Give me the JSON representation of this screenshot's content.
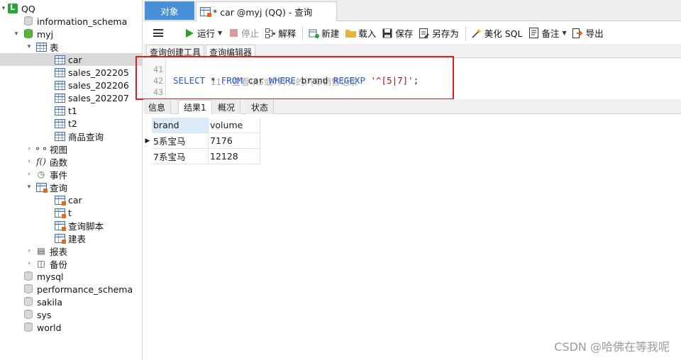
{
  "sidebar": {
    "connection": "QQ",
    "databases_top": [
      "information_schema"
    ],
    "active_db": "myj",
    "tables_group": "表",
    "tables": [
      "car",
      "sales_202205",
      "sales_202206",
      "sales_202207",
      "t1",
      "t2",
      "商品查询"
    ],
    "selected_table": "car",
    "groups": {
      "views": "视图",
      "functions": "函数",
      "events": "事件",
      "queries": "查询",
      "reports": "报表",
      "backups": "备份"
    },
    "queries": [
      "car",
      "t",
      "查询脚本",
      "建表"
    ],
    "databases_bottom": [
      "mysql",
      "performance_schema",
      "sakila",
      "sys",
      "world"
    ]
  },
  "tabs": {
    "objects": "对象",
    "editor": "* car @myj (QQ) - 查询"
  },
  "toolbar": {
    "run": "运行",
    "stop": "停止",
    "explain": "解释",
    "new": "新建",
    "load": "载入",
    "save": "保存",
    "save_as": "另存为",
    "beautify": "美化 SQL",
    "note": "备注",
    "export": "导出"
  },
  "editor_tabs": {
    "builder": "查询创建工具",
    "editor": "查询编辑器"
  },
  "editor": {
    "lines": [
      {
        "num": "41",
        "comment": "-- 11. 查看以5或7开头的汽车销售记录"
      },
      {
        "num": "42",
        "kw1": "SELECT",
        "star": " * ",
        "kw2": "FROM",
        "t1": " car ",
        "kw3": "WHERE",
        "t2": " brand ",
        "kw4": "REGEXP",
        "str": " '^[5|7]'",
        "end": ";"
      },
      {
        "num": "43"
      }
    ]
  },
  "result_tabs": {
    "info": "信息",
    "result1": "结果1",
    "profile": "概况",
    "status": "状态"
  },
  "result": {
    "columns": [
      "brand",
      "volume"
    ],
    "rows": [
      [
        "5系宝马",
        "7176"
      ],
      [
        "7系宝马",
        "12128"
      ]
    ]
  },
  "watermark": "CSDN @哈佛在等我呢"
}
